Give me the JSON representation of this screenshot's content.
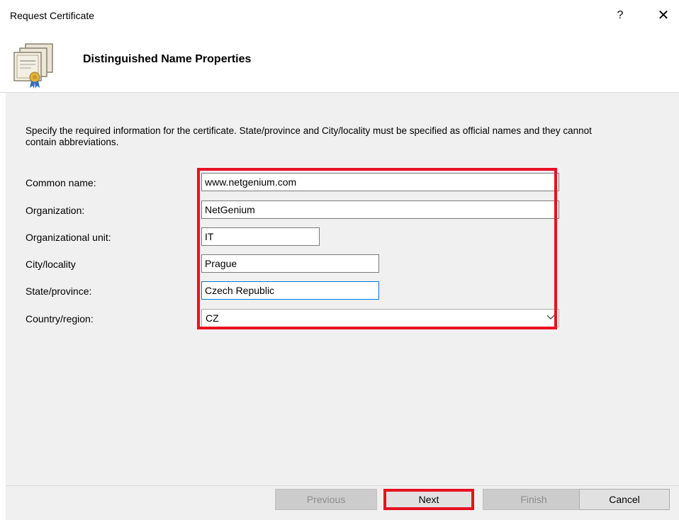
{
  "window": {
    "title": "Request Certificate",
    "help_label": "?",
    "close_label": "✕"
  },
  "header": {
    "title": "Distinguished Name Properties",
    "icon": "certificate-icon"
  },
  "instructions": "Specify the required information for the certificate. State/province and City/locality must be specified as official names and they cannot contain abbreviations.",
  "form": {
    "common_name": {
      "label": "Common name:",
      "value": "www.netgenium.com"
    },
    "organization": {
      "label": "Organization:",
      "value": "NetGenium"
    },
    "org_unit": {
      "label": "Organizational unit:",
      "value": "IT"
    },
    "city": {
      "label": "City/locality",
      "value": "Prague"
    },
    "state": {
      "label": "State/province:",
      "value": "Czech Republic"
    },
    "country": {
      "label": "Country/region:",
      "value": "CZ"
    }
  },
  "buttons": {
    "previous": "Previous",
    "next": "Next",
    "finish": "Finish",
    "cancel": "Cancel"
  },
  "colors": {
    "highlight": "#e81123",
    "focus": "#0078d7",
    "panel": "#f0f0f0"
  }
}
